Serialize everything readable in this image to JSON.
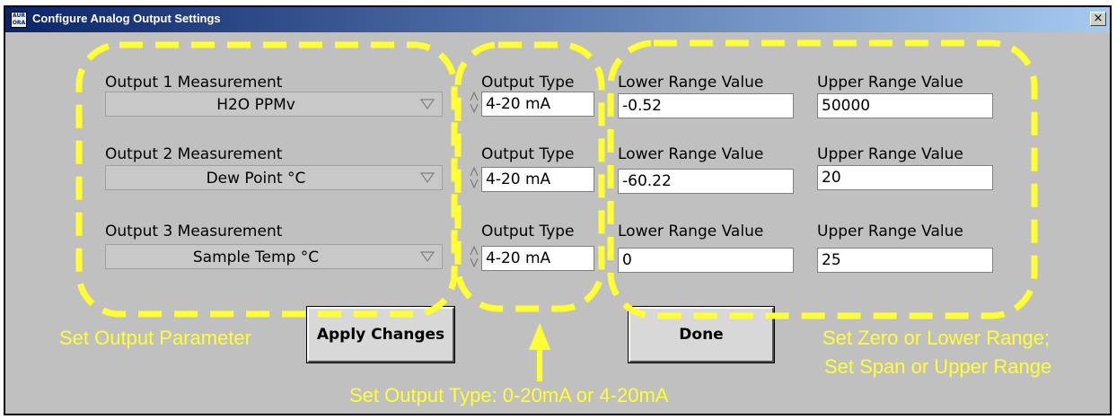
{
  "window": {
    "title": "Configure Analog Output Settings",
    "icon_text": "AUR ORA",
    "close_label": "×"
  },
  "outputs": [
    {
      "measurement_label": "Output 1 Measurement",
      "measurement_value": "H2O PPMv",
      "type_label": "Output Type",
      "type_value": "4-20 mA",
      "lower_label": "Lower Range Value",
      "lower_value": "-0.52",
      "upper_label": "Upper Range Value",
      "upper_value": "50000"
    },
    {
      "measurement_label": "Output 2 Measurement",
      "measurement_value": "Dew Point °C",
      "type_label": "Output Type",
      "type_value": "4-20 mA",
      "lower_label": "Lower Range Value",
      "lower_value": "-60.22",
      "upper_label": "Upper Range Value",
      "upper_value": "20"
    },
    {
      "measurement_label": "Output 3 Measurement",
      "measurement_value": "Sample Temp °C",
      "type_label": "Output Type",
      "type_value": "4-20 mA",
      "lower_label": "Lower Range Value",
      "lower_value": "0",
      "upper_label": "Upper Range Value",
      "upper_value": "25"
    }
  ],
  "buttons": {
    "apply": "Apply Changes",
    "done": "Done"
  },
  "annotations": {
    "color": "#ffff33",
    "set_output_parameter": "Set Output Parameter",
    "set_output_type": "Set Output Type: 0-20mA or 4-20mA",
    "set_zero": "Set Zero or Lower Range;",
    "set_span": "Set Span or Upper Range"
  }
}
